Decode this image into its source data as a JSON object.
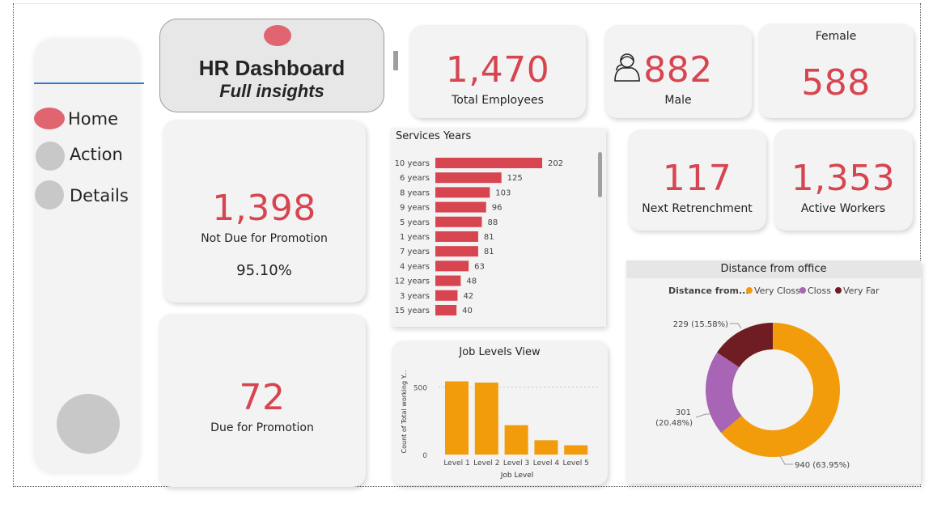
{
  "colors": {
    "accent": "#d64550",
    "sidebar_line": "#2f7bc8",
    "bar_red": "#d64550",
    "bar_orange": "#f29c0c",
    "donut_very_close": "#f29c0c",
    "donut_close": "#a865b5",
    "donut_very_far": "#6f1d23",
    "nav_active": "#e06570",
    "nav_inactive": "#c8c8c8"
  },
  "sidebar": {
    "items": [
      {
        "label": "Home",
        "active": true
      },
      {
        "label": "Action",
        "active": false
      },
      {
        "label": "Details",
        "active": false
      }
    ]
  },
  "header": {
    "title": "HR Dashboard",
    "subtitle": "Full insights"
  },
  "kpis": {
    "total_employees": {
      "value": "1,470",
      "label": "Total Employees"
    },
    "male": {
      "value": "882",
      "label": "Male",
      "icon": "person-icon"
    },
    "female": {
      "value": "588",
      "label": "Female"
    },
    "next_retrenchment": {
      "value": "117",
      "label": "Next Retrenchment"
    },
    "active_workers": {
      "value": "1,353",
      "label": "Active Workers"
    },
    "not_due_promotion": {
      "value": "1,398",
      "label": "Not Due for Promotion",
      "percent": "95.10%"
    },
    "due_promotion": {
      "value": "72",
      "label": "Due for Promotion"
    }
  },
  "chart_data": [
    {
      "id": "services_years",
      "type": "bar",
      "orientation": "horizontal",
      "title": "Services Years",
      "categories": [
        "10 years",
        "6 years",
        "8 years",
        "9 years",
        "5 years",
        "1 years",
        "7 years",
        "4 years",
        "12 years",
        "3 years",
        "15 years"
      ],
      "values": [
        202,
        125,
        103,
        96,
        88,
        81,
        81,
        63,
        48,
        42,
        40
      ],
      "data_labels": true,
      "scrollbar": true
    },
    {
      "id": "job_levels",
      "type": "bar",
      "orientation": "vertical",
      "title": "Job Levels View",
      "xlabel": "Job Level",
      "ylabel": "Count of Total working Y...",
      "categories": [
        "Level 1",
        "Level 2",
        "Level 3",
        "Level 4",
        "Level 5"
      ],
      "values": [
        543,
        534,
        218,
        106,
        69
      ],
      "yticks": [
        "0",
        "500"
      ],
      "ylim": [
        0,
        600
      ],
      "grid": true
    },
    {
      "id": "distance_from_office",
      "type": "pie",
      "style": "donut",
      "title": "Distance from office",
      "legend_title": "Distance from...",
      "legend_position": "top",
      "series": [
        {
          "name": "Very Closs",
          "value": 940,
          "label": "940 (63.95%)"
        },
        {
          "name": "Closs",
          "value": 301,
          "label": "301 (20.48%)"
        },
        {
          "name": "Very Far",
          "value": 229,
          "label": "229 (15.58%)"
        }
      ]
    }
  ]
}
